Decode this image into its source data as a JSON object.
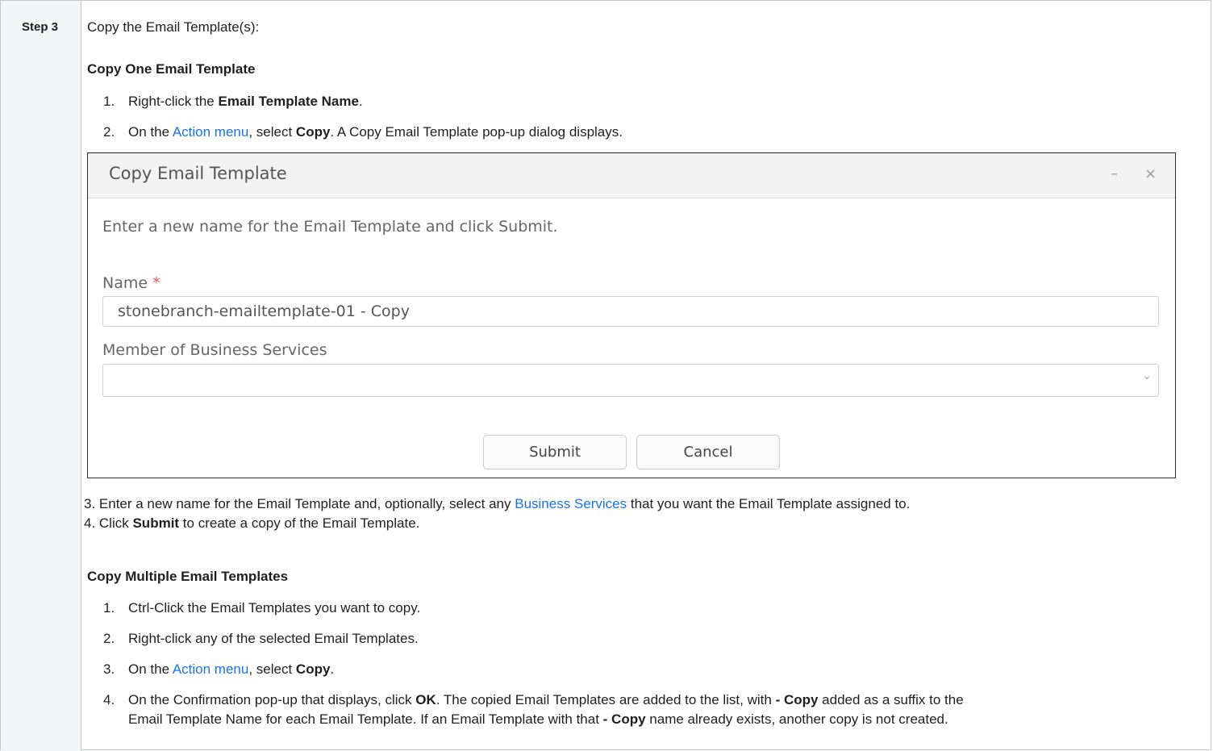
{
  "step": {
    "label": "Step 3"
  },
  "intro": "Copy the Email Template(s):",
  "copy_one": {
    "heading": "Copy One Email Template",
    "item1": {
      "num": "1.",
      "pre": "Right-click the ",
      "bold": "Email Template Name",
      "post": "."
    },
    "item2": {
      "num": "2.",
      "pre": "On the ",
      "link": "Action menu",
      "mid": ", select ",
      "bold": "Copy",
      "post": ". A Copy Email Template pop-up dialog displays."
    }
  },
  "dialog": {
    "title": "Copy Email Template",
    "minimize": "–",
    "close": "×",
    "instruction": "Enter a new name for the Email Template and click Submit.",
    "name_label": "Name",
    "required_mark": "*",
    "name_value": "stonebranch-emailtemplate-01 - Copy",
    "member_label": "Member of Business Services",
    "member_value": "",
    "dropdown_arrow": "⌄",
    "submit": "Submit",
    "cancel": "Cancel"
  },
  "after_dialog": {
    "line3_pre": "3. Enter a new name for the Email Template and, optionally, select any ",
    "line3_link": "Business Services",
    "line3_post": " that you want the Email Template assigned to.",
    "line4_pre": "4. Click ",
    "line4_bold": "Submit",
    "line4_post": " to create a copy of the Email Template."
  },
  "copy_multi": {
    "heading": "Copy Multiple Email Templates",
    "item1": {
      "num": "1.",
      "text": "Ctrl-Click the Email Templates you want to copy."
    },
    "item2": {
      "num": "2.",
      "text": "Right-click any of the selected Email Templates."
    },
    "item3": {
      "num": "3.",
      "pre": "On the ",
      "link": "Action menu",
      "mid": ", select ",
      "bold": "Copy",
      "post": "."
    },
    "item4": {
      "num": "4.",
      "pre": "On the Confirmation pop-up that displays, click ",
      "bold1": "OK",
      "mid": ". The copied Email Templates are added to the list, with ",
      "bold2": "- Copy",
      "post": " added as a suffix to the",
      "line2_pre": "Email Template Name for each Email Template. If an Email Template with that ",
      "line2_bold": "- Copy",
      "line2_post": " name already exists, another copy is not created."
    }
  }
}
